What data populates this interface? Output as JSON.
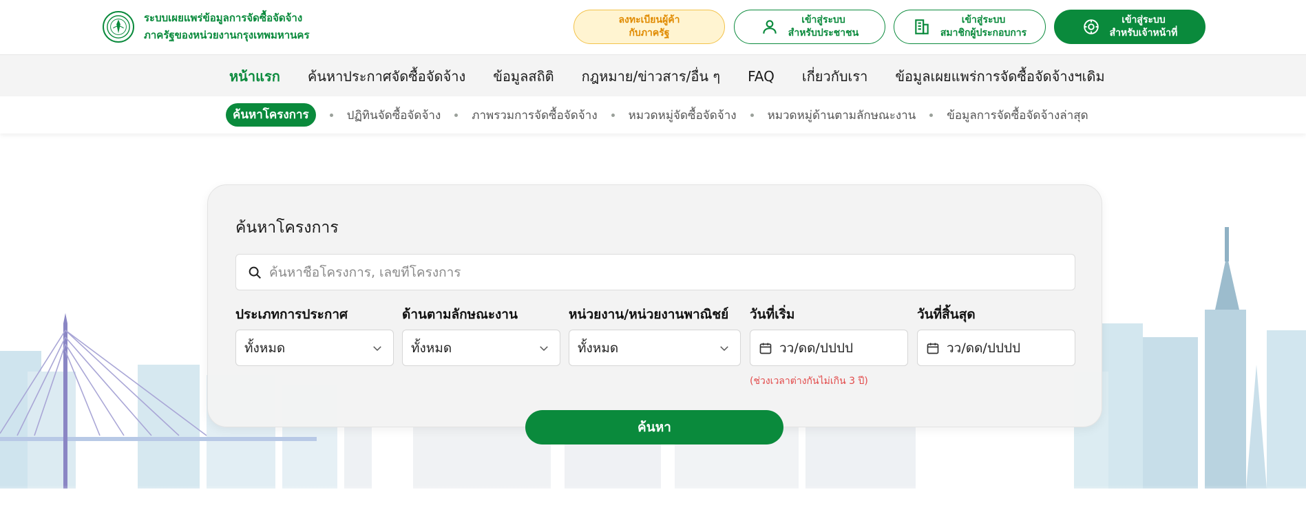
{
  "header": {
    "brand_line1": "ระบบเผยแพร่ข้อมูลการจัดซื้อจัดจ้าง",
    "brand_line2": "ภาครัฐของหน่วยงานกรุงเทพมหานคร",
    "register": {
      "line1": "ลงทะเบียนผู้ค้า",
      "line2": "กับภาครัฐ"
    },
    "citizen_login": {
      "line1": "เข้าสู่ระบบ",
      "line2": "สำหรับประชาชน",
      "icon": "user-icon"
    },
    "member_login": {
      "line1": "เข้าสู่ระบบ",
      "line2": "สมาชิกผู้ประกอบการ",
      "icon": "building-icon"
    },
    "officer_login": {
      "line1": "เข้าสู่ระบบ",
      "line2": "สำหรับเจ้าหน้าที่",
      "icon": "gear-icon"
    }
  },
  "main_nav": {
    "items": [
      {
        "label": "หน้าแรก",
        "active": true
      },
      {
        "label": "ค้นหาประกาศจัดซื้อจัดจ้าง"
      },
      {
        "label": "ข้อมูลสถิติ"
      },
      {
        "label": "กฎหมาย/ข่าวสาร/อื่น ๆ"
      },
      {
        "label": "FAQ"
      },
      {
        "label": "เกี่ยวกับเรา"
      },
      {
        "label": "ข้อมูลเผยแพร่การจัดซื้อจัดจ้างฯเดิม"
      }
    ]
  },
  "sub_nav": {
    "items": [
      {
        "label": "ค้นหาโครงการ",
        "active": true
      },
      {
        "label": "ปฏิทินจัดซื้อจัดจ้าง"
      },
      {
        "label": "ภาพรวมการจัดซื้อจัดจ้าง"
      },
      {
        "label": "หมวดหมู่จัดซื้อจัดจ้าง"
      },
      {
        "label": "หมวดหมู่ด้านตามลักษณะงาน"
      },
      {
        "label": "ข้อมูลการจัดซื้อจัดจ้างล่าสุด"
      }
    ]
  },
  "search_card": {
    "title": "ค้นหาโครงการ",
    "search_placeholder": "ค้นหาชื่อโครงการ, เลขที่โครงการ",
    "search_value": "",
    "filters": {
      "announce_type": {
        "label": "ประเภทการประกาศ",
        "value": "ทั้งหมด"
      },
      "work_category": {
        "label": "ด้านตามลักษณะงาน",
        "value": "ทั้งหมด"
      },
      "agency": {
        "label": "หน่วยงาน/หน่วยงานพาณิชย์",
        "value": "ทั้งหมด"
      },
      "start_date": {
        "label": "วันที่เริ่ม",
        "placeholder": "วว/ดด/ปปปป"
      },
      "end_date": {
        "label": "วันที่สิ้นสุด",
        "placeholder": "วว/ดด/ปปปป"
      }
    },
    "date_note": "(ช่วงเวลาต่างกันไม่เกิน 3 ปี)",
    "submit_label": "ค้นหา"
  },
  "colors": {
    "brand_green": "#0a8a3c",
    "register_bg": "#fff4d1",
    "register_text": "#e08a00",
    "note_red": "#e24a4a"
  }
}
